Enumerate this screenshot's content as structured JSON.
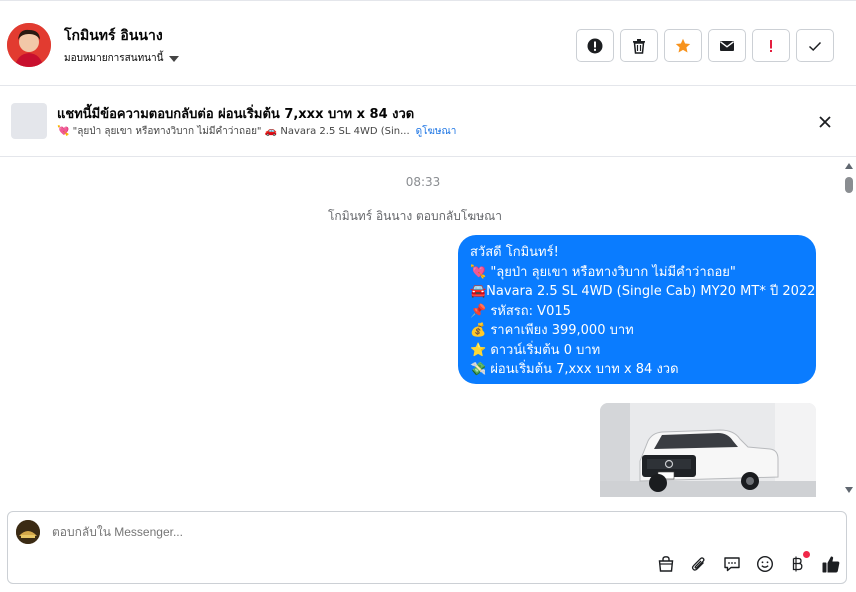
{
  "header": {
    "contact_name": "โกมินทร์ อินนาง",
    "assign_label": "มอบหมายการสนทนานี้",
    "actions": [
      {
        "icon": "info-circle-icon",
        "label": "!"
      },
      {
        "icon": "trash-icon",
        "label": ""
      },
      {
        "icon": "star-icon",
        "label": ""
      },
      {
        "icon": "mail-icon",
        "label": ""
      },
      {
        "icon": "exclamation-icon",
        "label": "!"
      },
      {
        "icon": "check-icon",
        "label": ""
      }
    ],
    "colors": {
      "star": "#f7931e",
      "exclamation": "#e41e3f"
    }
  },
  "ad_banner": {
    "title": "แชทนี้มีข้อความตอบกลับต่อ ผ่อนเริ่มต้น 7,xxx บาท x 84 งวด",
    "subtitle": "💘 \"ลุยป่า ลุยเขา หรือทางวิบาก ไม่มีคำว่าถอย\" 🚗 Navara 2.5 SL 4WD (Sin...",
    "link": "ดูโฆษณา"
  },
  "chat": {
    "timestamp": "08:33",
    "system_note": "โกมินทร์ อินนาง ตอบกลับโฆษณา",
    "message_lines": [
      "สวัสดี โกมินทร์!",
      "💘 \"ลุยป่า ลุยเขา หรือทางวิบาก ไม่มีคำว่าถอย\"",
      "🚘Navara 2.5 SL 4WD (Single Cab) MY20 MT* ปี 2022",
      "📌 รหัสรถ: V015",
      "💰 ราคาเพียง 399,000 บาท",
      "⭐ ดาวน์เริ่มต้น 0 บาท",
      "💸 ผ่อนเริ่มต้น 7,xxx บาท x 84 งวด"
    ],
    "bubble_color": "#0a7cff"
  },
  "composer": {
    "placeholder": "ตอบกลับใน Messenger...",
    "tools": [
      "bag-icon",
      "paperclip-icon",
      "speech-bubble-icon",
      "smiley-icon",
      "baht-icon",
      "thumbs-up-icon"
    ]
  }
}
